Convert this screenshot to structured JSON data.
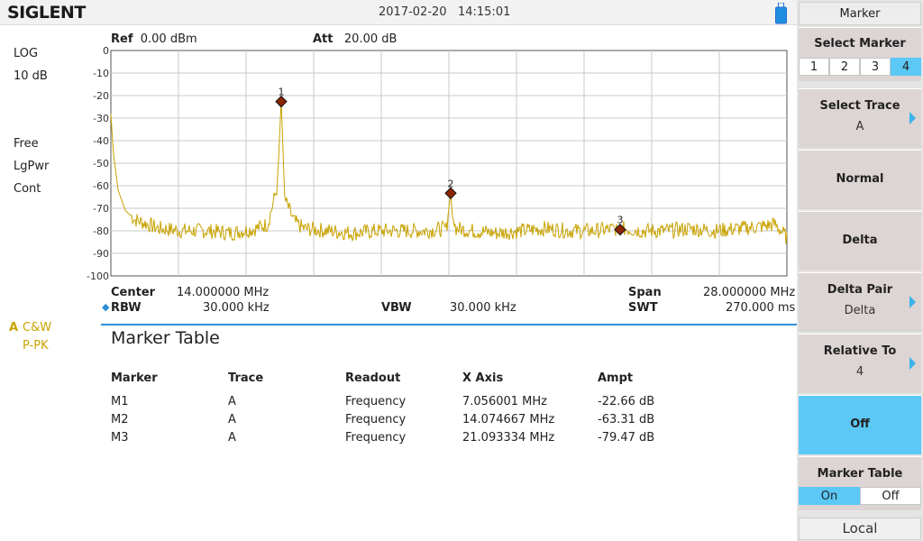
{
  "top": {
    "logo": "SIGLENT",
    "date": "2017-02-20",
    "time": "14:15:01"
  },
  "left_status": {
    "scale_type": "LOG",
    "scale_div": "10 dB",
    "sweep_mode": "Free",
    "avg_type": "LgPwr",
    "run_mode": "Cont",
    "trace_letter": "A",
    "trace_mode": "C&W",
    "trace_detector": "P-PK"
  },
  "header": {
    "ref_label": "Ref",
    "ref_value": "0.00 dBm",
    "att_label": "Att",
    "att_value": "20.00 dB"
  },
  "params": {
    "center_label": "Center",
    "center_value": "14.000000 MHz",
    "span_label": "Span",
    "span_value": "28.000000 MHz",
    "rbw_label": "RBW",
    "rbw_value": "30.000 kHz",
    "vbw_label": "VBW",
    "vbw_value": "30.000 kHz",
    "swt_label": "SWT",
    "swt_value": "270.000 ms"
  },
  "chart_data": {
    "type": "line",
    "x_unit": "MHz",
    "y_unit": "dB",
    "xlim": [
      0,
      28
    ],
    "ylim": [
      -100,
      0
    ],
    "y_ticks": [
      "0",
      "-10",
      "-20",
      "-30",
      "-40",
      "-50",
      "-60",
      "-70",
      "-80",
      "-90",
      "-100"
    ],
    "grid": true,
    "noise_floor": -80,
    "series": [
      {
        "x": [
          0,
          0.1,
          0.3,
          0.6,
          1.0,
          1.5,
          2.0,
          3.0,
          4.0,
          5.0,
          6.0,
          6.5,
          6.9,
          7.0,
          7.056,
          7.1,
          7.2,
          7.6,
          8.0,
          9.0,
          10.0,
          11.0,
          12.0,
          13.0,
          13.9,
          14.0,
          14.0747,
          14.15,
          14.3,
          15.0,
          16.0,
          17.0,
          18.0,
          19.0,
          20.0,
          21.0,
          21.0933,
          21.2,
          22.0,
          23.0,
          24.0,
          25.0,
          26.0,
          27.0,
          27.5,
          28.0
        ],
        "y": [
          -28,
          -45,
          -62,
          -71,
          -75,
          -77,
          -79,
          -80,
          -80,
          -81,
          -79,
          -77,
          -60,
          -35,
          -22.66,
          -35,
          -66,
          -76,
          -79,
          -80,
          -81,
          -80,
          -80,
          -80,
          -79,
          -70,
          -63.31,
          -74,
          -79,
          -80,
          -81,
          -80,
          -79,
          -80,
          -80,
          -79,
          -79.47,
          -79,
          -80,
          -80,
          -79,
          -80,
          -79,
          -78,
          -77,
          -83
        ]
      }
    ],
    "markers": [
      {
        "label": "1",
        "x": 7.056001,
        "y": -22.66
      },
      {
        "label": "2",
        "x": 14.074667,
        "y": -63.31
      },
      {
        "label": "3",
        "x": 21.093334,
        "y": -79.47
      }
    ],
    "colors": {
      "trace": "#c8a200",
      "marker": "#8b2500",
      "grid": "#c8c8c8"
    }
  },
  "marker_table": {
    "title": "Marker Table",
    "headers": [
      "Marker",
      "Trace",
      "Readout",
      "X Axis",
      "Ampt"
    ],
    "rows": [
      [
        "M1",
        "A",
        "Frequency",
        "7.056001 MHz",
        "-22.66 dB"
      ],
      [
        "M2",
        "A",
        "Frequency",
        "14.074667 MHz",
        "-63.31 dB"
      ],
      [
        "M3",
        "A",
        "Frequency",
        "21.093334 MHz",
        "-79.47 dB"
      ]
    ]
  },
  "softkeys": {
    "header": "Marker",
    "select_marker": {
      "title": "Select Marker",
      "options": [
        "1",
        "2",
        "3",
        "4"
      ],
      "selected": "4"
    },
    "select_trace": {
      "title": "Select Trace",
      "value": "A"
    },
    "normal": "Normal",
    "delta": "Delta",
    "delta_pair": {
      "title": "Delta Pair",
      "value": "Delta"
    },
    "relative_to": {
      "title": "Relative To",
      "value": "4"
    },
    "off": "Off",
    "marker_table": {
      "title": "Marker Table",
      "options": [
        "On",
        "Off"
      ],
      "selected": "On"
    },
    "local": "Local"
  },
  "ui_colors": {
    "accent": "#5bc8f5",
    "softkey_bg": "#ddd4d4",
    "divider": "#2f8fd5",
    "trace_label": "#c8a200"
  }
}
